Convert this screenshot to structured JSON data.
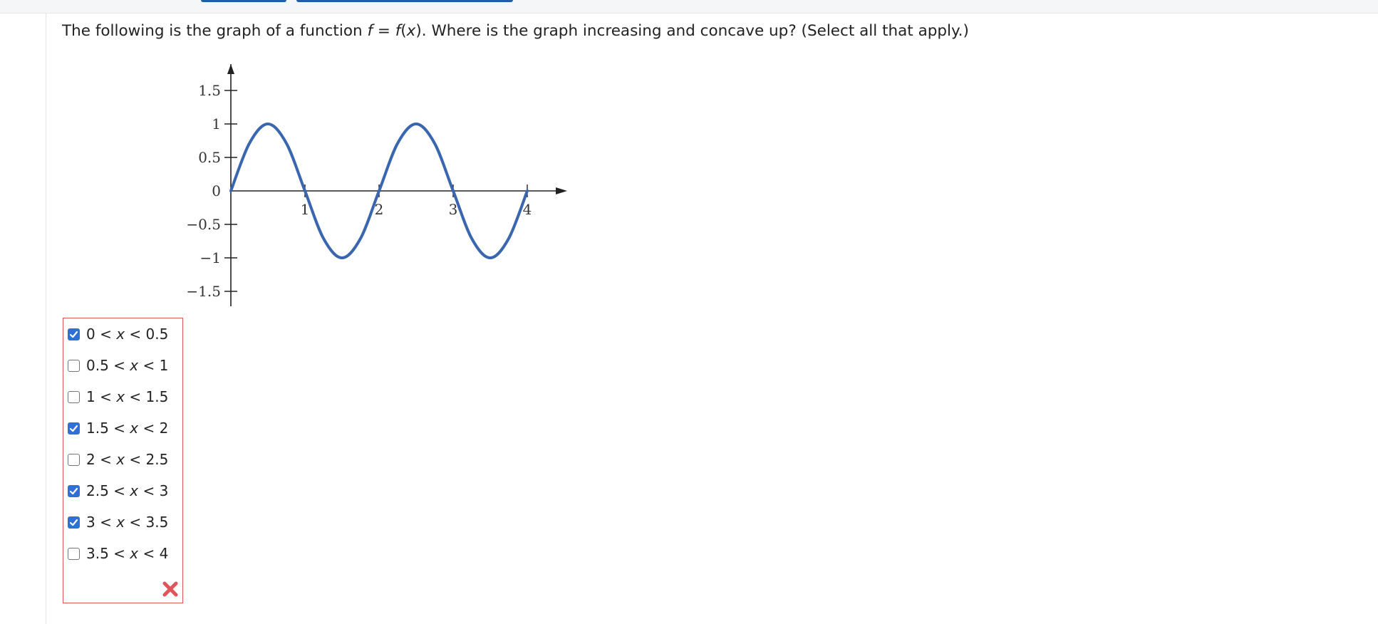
{
  "question": {
    "prefix": "The following is the graph of a function ",
    "f": "f",
    "eq": " = ",
    "fx_f": "f",
    "fx_open": "(",
    "fx_x": "x",
    "fx_close": ")",
    "suffix": ". Where is the graph increasing and concave up? (Select all that apply.)"
  },
  "graph": {
    "y_ticks": [
      "1.5",
      "1",
      "0.5",
      "0",
      "−0.5",
      "−1",
      "−1.5"
    ],
    "x_ticks": [
      "1",
      "2",
      "3",
      "4"
    ]
  },
  "chart_data": {
    "type": "line",
    "title": "",
    "xlabel": "",
    "ylabel": "",
    "function": "sin(pi*x/0.5... ) period 2, amplitude 1",
    "x": [
      0,
      0.25,
      0.5,
      0.75,
      1,
      1.25,
      1.5,
      1.75,
      2,
      2.25,
      2.5,
      2.75,
      3,
      3.25,
      3.5,
      3.75,
      4
    ],
    "series": [
      {
        "values": [
          0,
          0.71,
          1,
          0.71,
          0,
          -0.71,
          -1,
          -0.71,
          0,
          0.71,
          1,
          0.71,
          0,
          -0.71,
          -1,
          -0.71,
          0
        ]
      }
    ],
    "xlim": [
      0,
      4.5
    ],
    "ylim": [
      -1.5,
      1.5
    ],
    "line_color": "#3a66b0",
    "grid": false,
    "legend": "none"
  },
  "options": [
    {
      "a": "0",
      "b": "0.5",
      "checked": true
    },
    {
      "a": "0.5",
      "b": "1",
      "checked": false
    },
    {
      "a": "1",
      "b": "1.5",
      "checked": false
    },
    {
      "a": "1.5",
      "b": "2",
      "checked": true
    },
    {
      "a": "2",
      "b": "2.5",
      "checked": false
    },
    {
      "a": "2.5",
      "b": "3",
      "checked": true
    },
    {
      "a": "3",
      "b": "3.5",
      "checked": true
    },
    {
      "a": "3.5",
      "b": "4",
      "checked": false
    }
  ],
  "option_parts": {
    "lt": " < ",
    "var": "x"
  },
  "status": {
    "icon": "incorrect-x-icon",
    "color": "#e0555a"
  },
  "colors": {
    "accent": "#2f6fd6",
    "error": "#e0555a",
    "tab": "#1f5fa8"
  }
}
